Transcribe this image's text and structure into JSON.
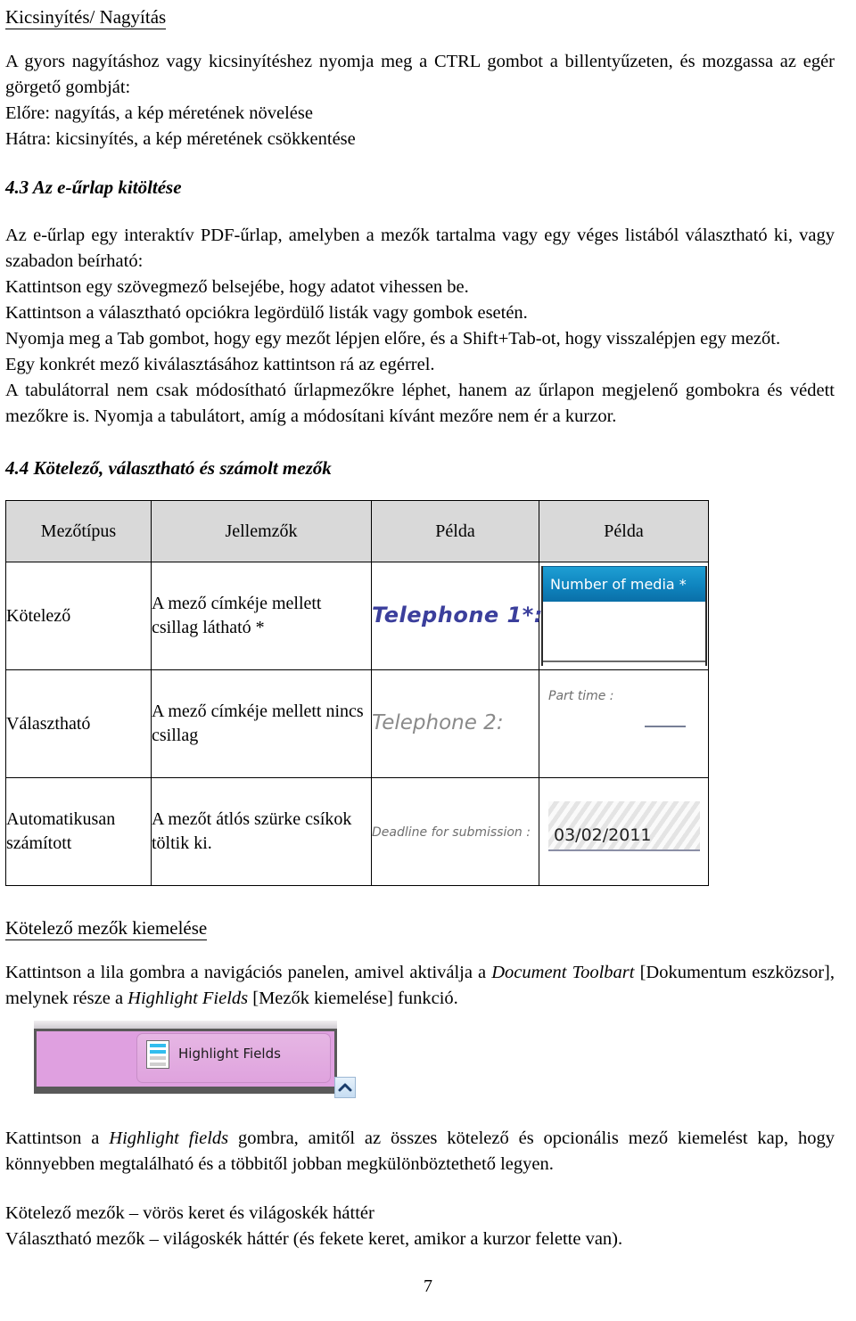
{
  "document": {
    "page_number": "7"
  },
  "zoom_section": {
    "heading": "Kicsinyítés/ Nagyítás",
    "intro": "A gyors nagyításhoz vagy kicsinyítéshez nyomja meg a CTRL gombot a billentyűzeten, és mozgassa az egér görgető gombját:",
    "bullets": [
      "Előre: nagyítás, a kép méretének növelése",
      "Hátra: kicsinyítés, a kép méretének csökkentése"
    ]
  },
  "section_4_3": {
    "heading": "4.3 Az e-űrlap kitöltése",
    "intro": "Az e-űrlap egy interaktív PDF-űrlap, amelyben a mezők tartalma vagy egy véges listából választható ki, vagy szabadon beírható:",
    "bullets": [
      "Kattintson egy szövegmező belsejébe, hogy adatot vihessen be.",
      "Kattintson a választható opciókra legördülő listák vagy gombok esetén.",
      "Nyomja meg a Tab gombot, hogy egy mezőt lépjen előre, és a Shift+Tab-ot, hogy visszalépjen egy mezőt.",
      "Egy konkrét mező kiválasztásához kattintson rá az egérrel."
    ],
    "closing": "A tabulátorral nem csak módosítható űrlapmezőkre léphet, hanem az űrlapon megjelenő gombokra és védett mezőkre is. Nyomja a tabulátort, amíg a módosítani kívánt mezőre nem ér a kurzor."
  },
  "section_4_4": {
    "heading": "4.4 Kötelező, választható és számolt mezők",
    "table": {
      "headers": [
        "Mezőtípus",
        "Jellemzők",
        "Példa",
        "Példa"
      ],
      "rows": [
        {
          "type": "Kötelező",
          "characteristics": "A mező címkéje mellett csillag látható *",
          "example_label": "Telephone 1*:",
          "example2_label": "Number of media *"
        },
        {
          "type": "Választható",
          "characteristics": "A mező címkéje mellett nincs csillag",
          "example_label": "Telephone 2:",
          "example2_label": "Part time :"
        },
        {
          "type": "Automatikusan számított",
          "characteristics": "A mezőt átlós szürke csíkok töltik ki.",
          "example_label": "Deadline for submission :",
          "example2_label": "03/02/2011"
        }
      ]
    }
  },
  "highlight_section": {
    "heading": "Kötelező mezők kiemelése",
    "paragraph_a1": "Kattintson a lila gombra a navigációs panelen, amivel aktiválja a ",
    "paragraph_a_italic1": "Document Toolbart",
    "paragraph_a2": " [Dokumentum eszközsor], melynek része a ",
    "paragraph_a_italic2": "Highlight Fields",
    "paragraph_a3": " [Mezők kiemelése] funkció.",
    "screenshot": {
      "button_label": "Highlight Fields",
      "chevron_icon": "chevron-up-icon",
      "document_icon": "document-lines-icon"
    },
    "paragraph_b1": "Kattintson a ",
    "paragraph_b_italic": "Highlight fields",
    "paragraph_b2": " gombra, amitől az összes kötelező és opcionális mező kiemelést kap, hogy könnyebben megtalálható és a többitől jobban megkülönböztethető legyen.",
    "legend": [
      "Kötelező mezők – vörös keret és világoskék háttér",
      "Választható mezők – világoskék háttér (és fekete keret, amikor a kurzor felette van)."
    ]
  },
  "colors": {
    "table_header_bg": "#d9d9d9",
    "required_field_blue": "#0f84be",
    "toolbar_purple": "#dfa0e0",
    "label_navy": "#3b3f9c",
    "label_gray": "#8a8a8a"
  }
}
